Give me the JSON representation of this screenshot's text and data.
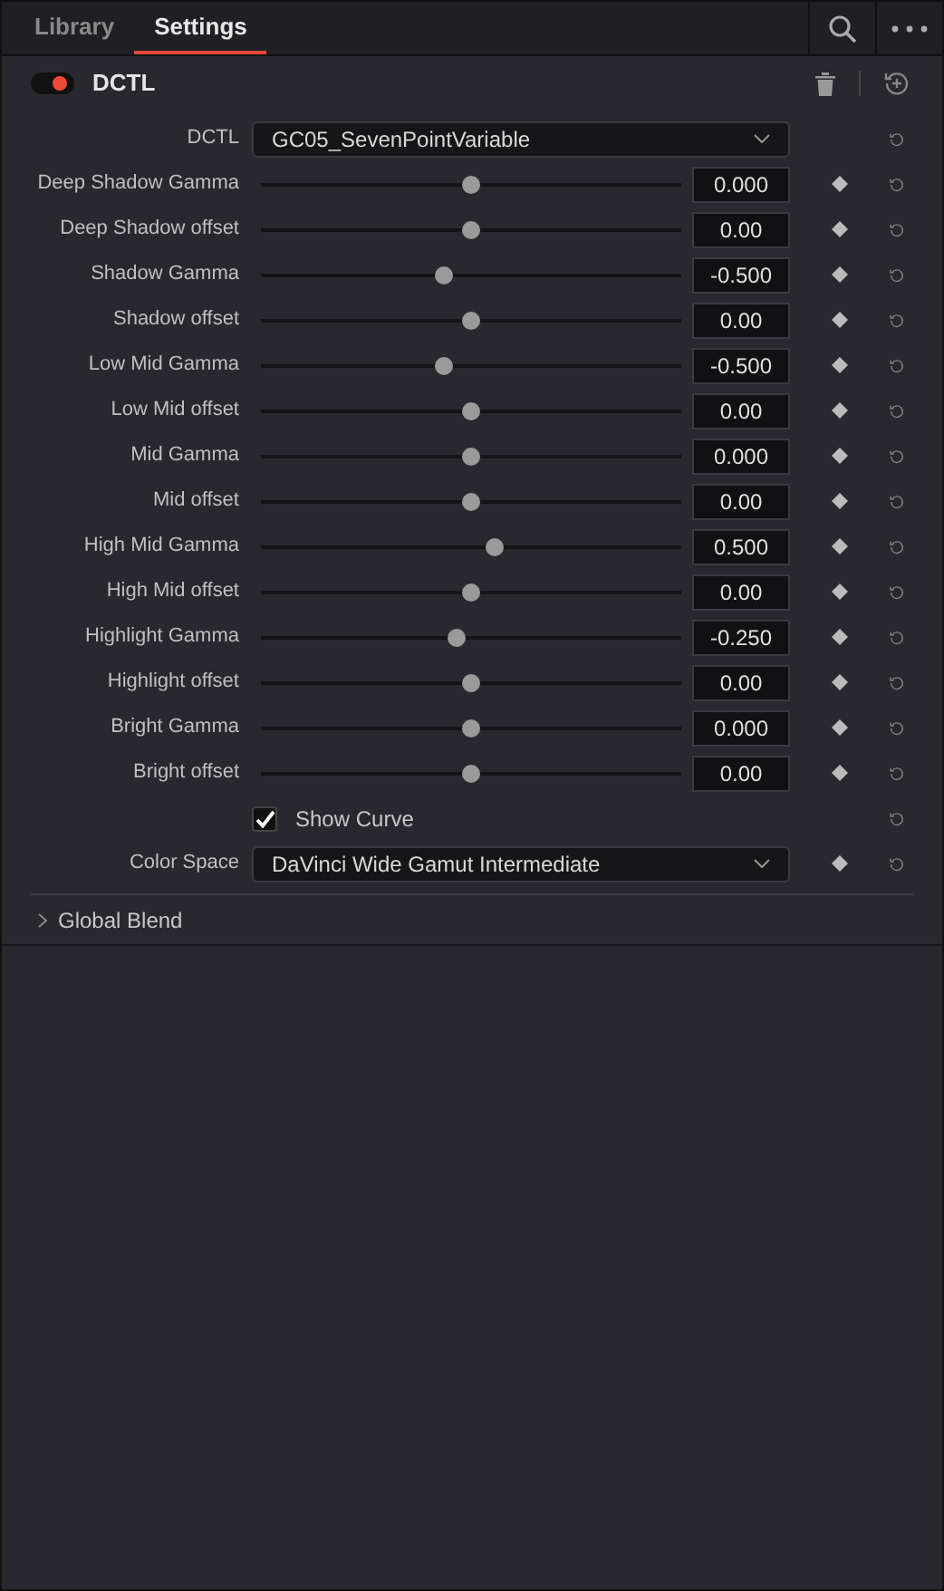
{
  "tabs": [
    {
      "label": "Library",
      "selected": false
    },
    {
      "label": "Settings",
      "selected": true
    }
  ],
  "effect": {
    "title": "DCTL",
    "enabled": true
  },
  "dctl": {
    "label": "DCTL",
    "value": "GC05_SevenPointVariable"
  },
  "params": [
    {
      "label": "Deep Shadow Gamma",
      "level": 0.5,
      "value": "0.000"
    },
    {
      "label": "Deep Shadow offset",
      "level": 0.5,
      "value": "0.00"
    },
    {
      "label": "Shadow Gamma",
      "level": 0.435,
      "value": "-0.500"
    },
    {
      "label": "Shadow offset",
      "level": 0.5,
      "value": "0.00"
    },
    {
      "label": "Low Mid Gamma",
      "level": 0.435,
      "value": "-0.500"
    },
    {
      "label": "Low Mid offset",
      "level": 0.5,
      "value": "0.00"
    },
    {
      "label": "Mid Gamma",
      "level": 0.5,
      "value": "0.000"
    },
    {
      "label": "Mid offset",
      "level": 0.5,
      "value": "0.00"
    },
    {
      "label": "High Mid Gamma",
      "level": 0.556,
      "value": "0.500"
    },
    {
      "label": "High Mid offset",
      "level": 0.5,
      "value": "0.00"
    },
    {
      "label": "Highlight Gamma",
      "level": 0.466,
      "value": "-0.250"
    },
    {
      "label": "Highlight offset",
      "level": 0.5,
      "value": "0.00"
    },
    {
      "label": "Bright Gamma",
      "level": 0.5,
      "value": "0.000"
    },
    {
      "label": "Bright offset",
      "level": 0.5,
      "value": "0.00"
    }
  ],
  "show_curve": {
    "label": "Show Curve",
    "checked": true
  },
  "color_space": {
    "label": "Color Space",
    "value": "DaVinci Wide Gamut Intermediate"
  },
  "global_blend": {
    "label": "Global Blend",
    "expanded": false
  }
}
